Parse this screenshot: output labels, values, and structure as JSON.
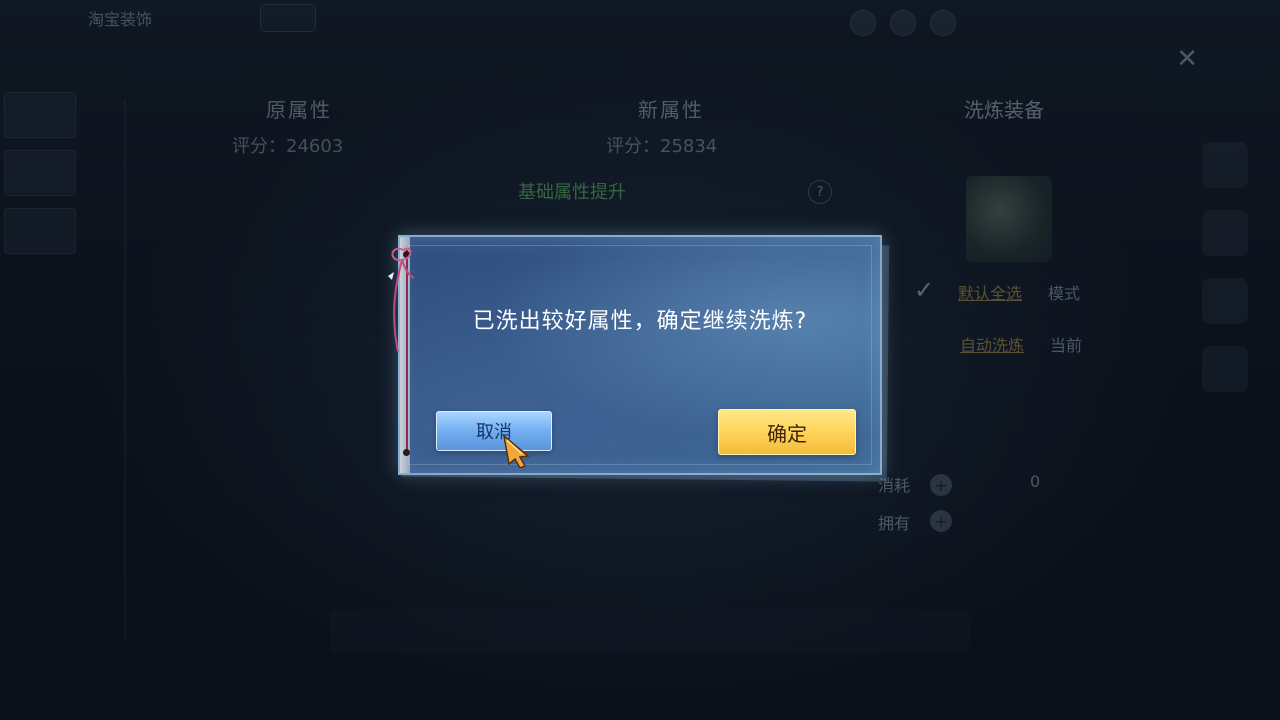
{
  "header": {
    "title": "淘宝装饰"
  },
  "columns": {
    "original": {
      "label": "原属性",
      "score": "评分：24603"
    },
    "new": {
      "label": "新属性",
      "score": "评分：25834"
    },
    "hint": "基础属性提升"
  },
  "right_panel": {
    "title": "洗炼装备",
    "line1_link": "默认全选",
    "line1_rest": "模式",
    "line2_link": "自动洗炼",
    "line2_rest": "当前",
    "cost_label": "消耗",
    "cost_value": "0",
    "owned_label": "拥有"
  },
  "dialog": {
    "message": "已洗出较好属性，确定继续洗炼?",
    "cancel_label": "取消",
    "confirm_label": "确定"
  },
  "colors": {
    "dialog_bg": "#36588a",
    "cancel_button": "#73aef0",
    "confirm_button": "#ffd45a",
    "hint_green": "#6ad26a"
  },
  "icons": [
    "close-icon",
    "check-icon",
    "plus-icon",
    "cursor-pointer-icon",
    "ribbon-icon",
    "question-icon"
  ]
}
